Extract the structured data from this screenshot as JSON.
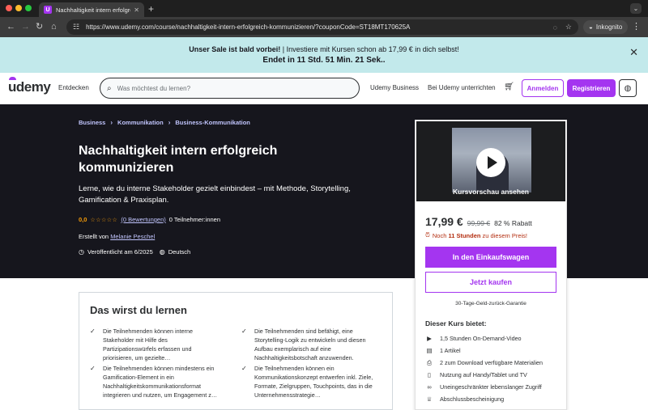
{
  "browser": {
    "tab_title": "Nachhaltigkeit intern erfolgreich",
    "tab_favicon_letter": "U",
    "url": "https://www.udemy.com/course/nachhaltigkeit-intern-erfolgreich-kommunizieren/?couponCode=ST18MT170625A",
    "incognito_label": "Inkognito"
  },
  "banner": {
    "bold_text": "Unser Sale ist bald vorbei!",
    "text": " | Investiere mit Kursen schon ab 17,99 € in dich selbst!",
    "countdown": "Endet in 11 Std. 51 Min. 21 Sek.."
  },
  "header": {
    "logo": "udemy",
    "explore": "Entdecken",
    "search_placeholder": "Was möchtest du lernen?",
    "business": "Udemy Business",
    "teach": "Bei Udemy unterrichten",
    "login": "Anmelden",
    "register": "Registrieren"
  },
  "hero": {
    "breadcrumb": [
      "Business",
      "Kommunikation",
      "Business-Kommunikation"
    ],
    "title": "Nachhaltigkeit intern erfolgreich kommunizieren",
    "subtitle": "Lerne, wie du interne Stakeholder gezielt einbindest – mit Methode, Storytelling, Gamification & Praxisplan.",
    "rating": "0,0",
    "rating_count": "(0 Bewertungen)",
    "students": "0 Teilnehmer:innen",
    "created_by_label": "Erstellt von ",
    "instructor": "Melanie Peschel",
    "published": "Veröffentlicht am 6/2025",
    "language": "Deutsch"
  },
  "sidebar": {
    "preview_label": "Kursvorschau ansehen",
    "price": "17,99 €",
    "original_price": "99,99 €",
    "discount": "82 % Rabatt",
    "timer_prefix": "Noch ",
    "timer_bold": "11 Stunden",
    "timer_suffix": " zu diesem Preis!",
    "add_to_cart": "In den Einkaufswagen",
    "buy_now": "Jetzt kaufen",
    "guarantee": "30-Tage-Geld-zurück-Garantie",
    "includes_title": "Dieser Kurs bietet:",
    "includes": [
      {
        "icon": "video-icon",
        "text": "1,5 Stunden On-Demand-Video"
      },
      {
        "icon": "article-icon",
        "text": "1 Artikel"
      },
      {
        "icon": "download-icon",
        "text": "2 zum Download verfügbare Materialien"
      },
      {
        "icon": "mobile-icon",
        "text": "Nutzung auf Handy/Tablet und TV"
      },
      {
        "icon": "infinity-icon",
        "text": "Uneingeschränkter lebenslanger Zugriff"
      },
      {
        "icon": "certificate-icon",
        "text": "Abschlussbescheinigung"
      }
    ]
  },
  "learn": {
    "title": "Das wirst du lernen",
    "items": [
      "Die Teilnehmenden können interne Stakeholder mit Hilfe des Partizipationswürfels erfassen und priorisieren, um gezielte…",
      "Die Teilnehmenden sind befähigt, eine Storytelling-Logik zu entwickeln und diesen Aufbau exemplarisch auf eine Nachhaltigkeitsbotschaft anzuwenden.",
      "Die Teilnehmenden können mindestens ein Gamification-Element in ein Nachhaltigkeitskommunikationsformat integrieren und nutzen, um Engagement z…",
      "Die Teilnehmenden können ein Kommunikationskonzept entwerfen inkl. Ziele, Formate, Zielgruppen, Touchpoints, das in die Unternehmensstrategie…"
    ]
  },
  "colors": {
    "accent": "#a435f0",
    "hero_bg": "#16161d",
    "banner_bg": "#c2e9eb",
    "link_light": "#c0c4fc",
    "star": "#f69c08",
    "timer_red": "#b32d0f"
  }
}
